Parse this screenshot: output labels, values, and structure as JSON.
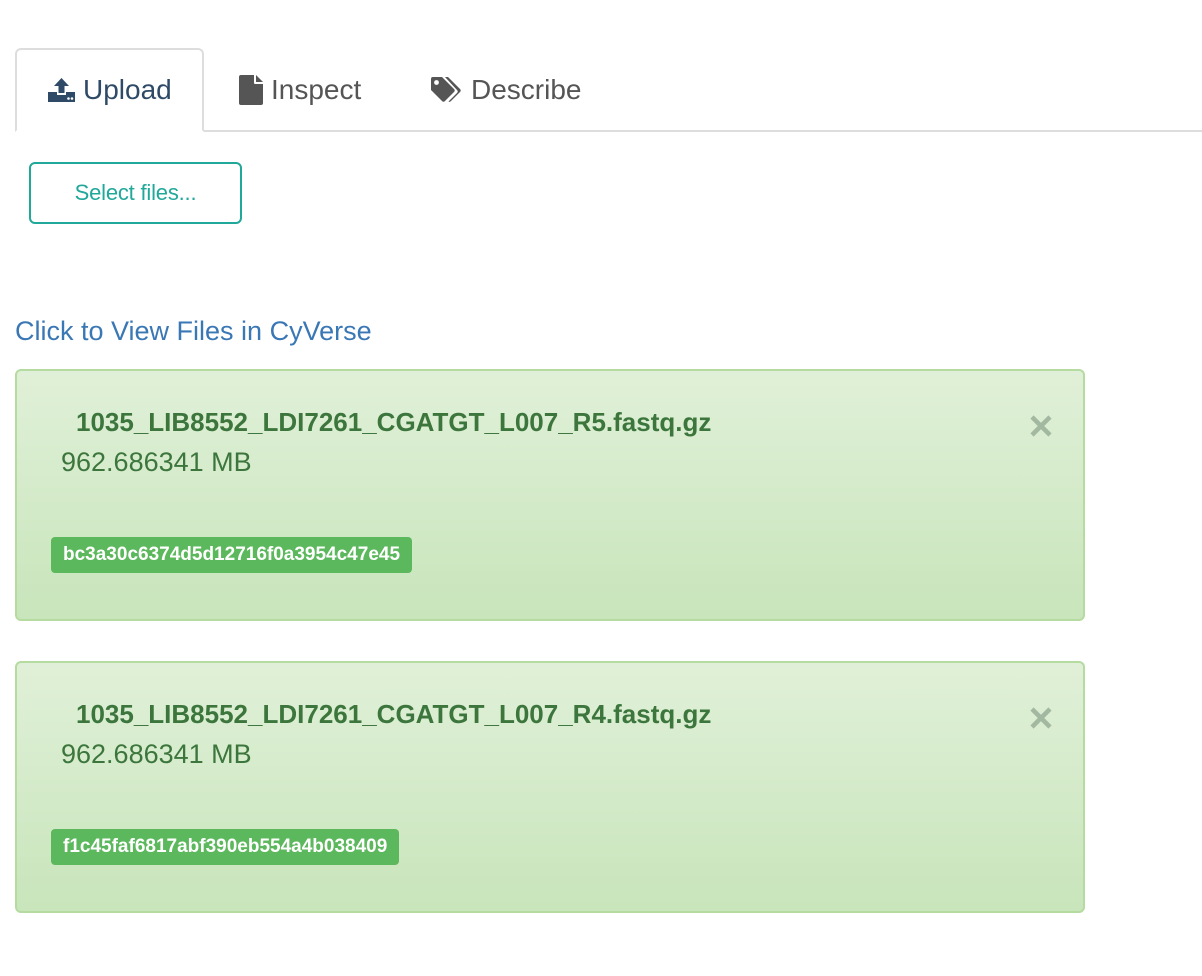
{
  "tabs": [
    {
      "label": "Upload",
      "icon": "upload-icon",
      "active": true
    },
    {
      "label": "Inspect",
      "icon": "file-icon",
      "active": false
    },
    {
      "label": "Describe",
      "icon": "tags-icon",
      "active": false
    }
  ],
  "upload": {
    "select_button_label": "Select files...",
    "view_link_label": "Click to View Files in CyVerse"
  },
  "files": [
    {
      "name": "1035_LIB8552_LDI7261_CGATGT_L007_R5.fastq.gz",
      "size": "962.686341 MB",
      "checksum": "bc3a30c6374d5d12716f0a3954c47e45"
    },
    {
      "name": "1035_LIB8552_LDI7261_CGATGT_L007_R4.fastq.gz",
      "size": "962.686341 MB",
      "checksum": "f1c45faf6817abf390eb554a4b038409"
    }
  ],
  "colors": {
    "accent_teal": "#20a89a",
    "link_blue": "#3a77b5",
    "success_text": "#3c763d",
    "success_badge": "#5cb85c",
    "card_border": "#b5dba0"
  }
}
